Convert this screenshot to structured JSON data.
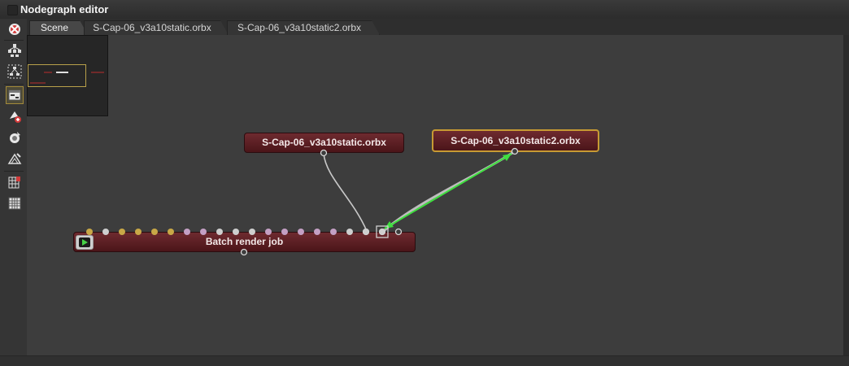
{
  "window": {
    "title": "Nodegraph editor"
  },
  "toolbar": {
    "tools": [
      {
        "name": "close-graph-icon",
        "active": false
      },
      {
        "name": "arrange-graph-icon",
        "active": false
      },
      {
        "name": "arrange-selection-icon",
        "active": false
      },
      {
        "name": "show-minimap-icon",
        "active": true
      },
      {
        "name": "load-node-icon",
        "active": false
      },
      {
        "name": "camera-node-icon",
        "active": false
      },
      {
        "name": "geometry-node-icon",
        "active": false
      },
      {
        "name": "render-target-icon",
        "active": false
      },
      {
        "name": "grid-icon",
        "active": false
      }
    ]
  },
  "tabs": [
    {
      "label": "Scene",
      "active": true
    },
    {
      "label": "S-Cap-06_v3a10static.orbx",
      "active": false
    },
    {
      "label": "S-Cap-06_v3a10static2.orbx",
      "active": false
    }
  ],
  "nodes": {
    "static": {
      "label": "S-Cap-06_v3a10static.orbx",
      "selected": false
    },
    "static2": {
      "label": "S-Cap-06_v3a10static2.orbx",
      "selected": true
    },
    "batch": {
      "label": "Batch render job",
      "selected": false
    }
  },
  "batch_inputs": [
    "#c9a847",
    "#cfcfcf",
    "#c9a847",
    "#c9a847",
    "#c9a847",
    "#c9a847",
    "#c4a0c4",
    "#c4a0c4",
    "#cfcfcf",
    "#cfcfcf",
    "#cfcfcf",
    "#c4a0c4",
    "#c4a0c4",
    "#c4a0c4",
    "#c4a0c4",
    "#c4a0c4",
    "#cfcfcf",
    "#cfcfcf",
    "#cfcfcf"
  ],
  "colors": {
    "node_fill": "#5c1f24",
    "selection_border": "#c79a33",
    "drag_link": "#3fe03f",
    "link": "#c8c8c8"
  }
}
